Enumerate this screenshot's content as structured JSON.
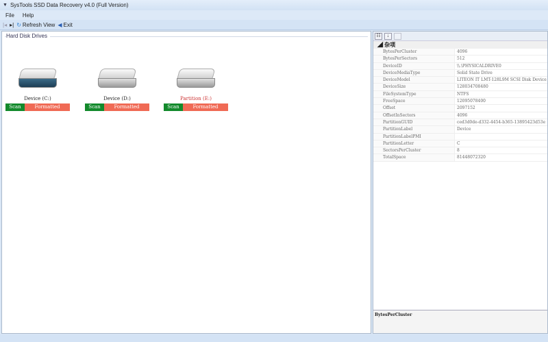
{
  "window": {
    "title": "SysTools SSD Data Recovery v4.0 (Full Version)"
  },
  "menu": {
    "file": "File",
    "help": "Help"
  },
  "toolbar": {
    "first": "|◂",
    "next": "▸|",
    "refresh": "Refresh View",
    "exit": "Exit"
  },
  "left": {
    "group_title": "Hard Disk Drives",
    "devices": [
      {
        "name": "Device (C:)",
        "scan": "Scan",
        "status": "Formatted"
      },
      {
        "name": "Device (D:)",
        "scan": "Scan",
        "status": "Formatted"
      },
      {
        "name": "Partition (E:)",
        "scan": "Scan",
        "status": "Formatted"
      }
    ]
  },
  "properties": {
    "category": "杂项",
    "rows": [
      {
        "k": "BytesPerCluster",
        "v": "4096"
      },
      {
        "k": "BytesPerSectors",
        "v": "512"
      },
      {
        "k": "DeviceID",
        "v": "\\\\.\\PHYSICALDRIVE0"
      },
      {
        "k": "DeviceMediaType",
        "v": "Solid State Drive"
      },
      {
        "k": "DeviceModel",
        "v": "LITEON IT LMT-128L9M SCSI Disk Device"
      },
      {
        "k": "DeviceSize",
        "v": "128034708480"
      },
      {
        "k": "FileSystemType",
        "v": "NTFS"
      },
      {
        "k": "FreeSpace",
        "v": "12095078400"
      },
      {
        "k": "Offset",
        "v": "2097152"
      },
      {
        "k": "OffsetInSectors",
        "v": "4096"
      },
      {
        "k": "PartitionGUID",
        "v": "ced3d0de-d332-4454-b365-13895423d53e"
      },
      {
        "k": "PartitionLabel",
        "v": "Device"
      },
      {
        "k": "PartitionLabelPMI",
        "v": ""
      },
      {
        "k": "PartitionLetter",
        "v": "C"
      },
      {
        "k": "SectorsPerCluster",
        "v": "8"
      },
      {
        "k": "TotalSpace",
        "v": "81448072320"
      }
    ],
    "description_title": "BytesPerCluster"
  }
}
